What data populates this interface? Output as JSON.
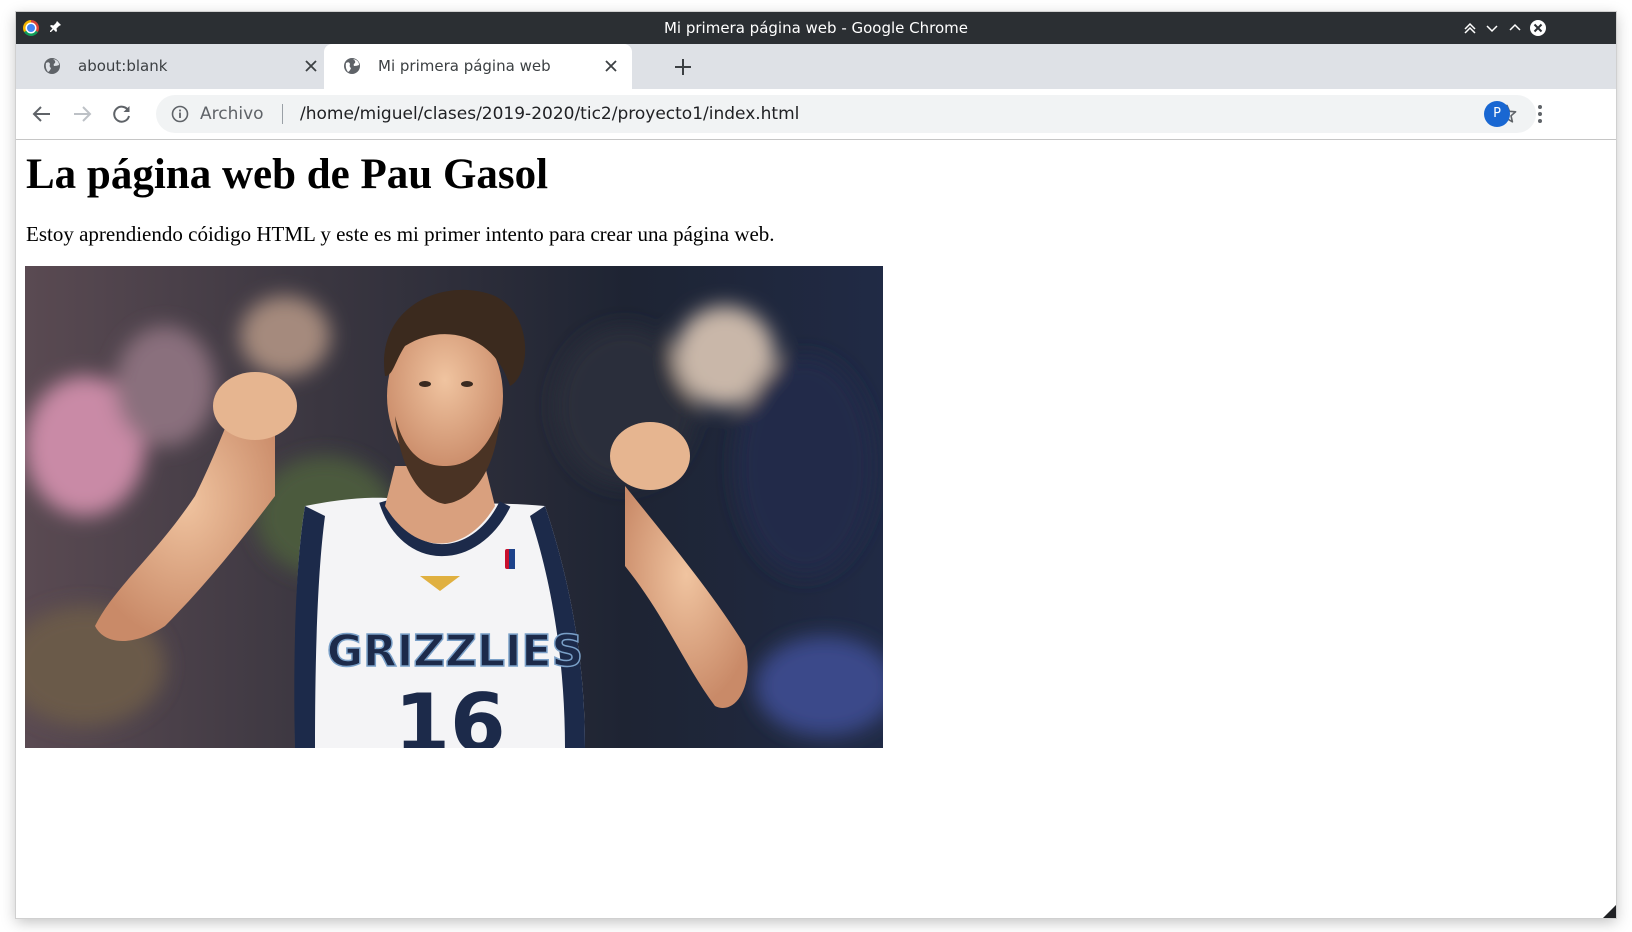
{
  "window": {
    "title": "Mi primera página web - Google Chrome"
  },
  "tabs": [
    {
      "label": "about:blank",
      "active": false
    },
    {
      "label": "Mi primera página web",
      "active": true
    }
  ],
  "toolbar": {
    "security_label": "Archivo",
    "url": "/home/miguel/clases/2019-2020/tic2/proyecto1/index.html",
    "profile_initial": "P"
  },
  "page": {
    "heading": "La página web de Pau Gasol",
    "paragraph": "Estoy aprendiendo cóidigo HTML y este es mi primer intento para crear una página web.",
    "image": {
      "jersey_text": "GRIZZLIES",
      "jersey_number": "16"
    }
  },
  "colors": {
    "titlebar": "#2b2f33",
    "tabstrip": "#dee1e6",
    "avatar": "#1967d2",
    "omnibox": "#f1f3f4"
  }
}
